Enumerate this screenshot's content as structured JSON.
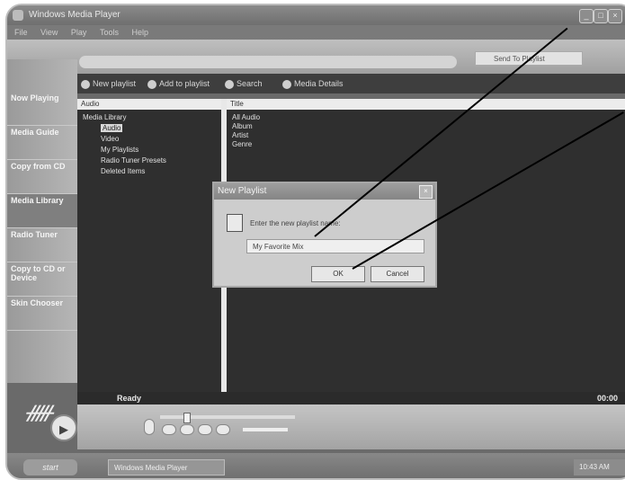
{
  "window": {
    "title": "Windows Media Player"
  },
  "menu": [
    "File",
    "View",
    "Play",
    "Tools",
    "Help"
  ],
  "send_to": "Send To Playlist",
  "toolbar": [
    "New playlist",
    "Add to playlist",
    "Search",
    "Media Details"
  ],
  "sidebar": {
    "items": [
      "Now Playing",
      "Media Guide",
      "Copy from CD",
      "Media Library",
      "Radio Tuner",
      "Copy to CD or Device",
      "Skin Chooser"
    ]
  },
  "tree": {
    "header": "Audio",
    "items": [
      "Media Library",
      "Audio",
      "Video",
      "My Playlists",
      "Radio Tuner Presets",
      "Deleted Items"
    ]
  },
  "list": {
    "header": "Title",
    "items": [
      "All Audio",
      "Album",
      "Artist",
      "Genre"
    ]
  },
  "dialog": {
    "title": "New Playlist",
    "prompt": "Enter the new playlist name:",
    "value": "My Favorite Mix",
    "ok": "OK",
    "cancel": "Cancel"
  },
  "status": {
    "text": "Ready",
    "time": "00:00"
  },
  "taskbar": {
    "start": "start",
    "task": "Windows Media Player",
    "clock": "10:43 AM"
  }
}
